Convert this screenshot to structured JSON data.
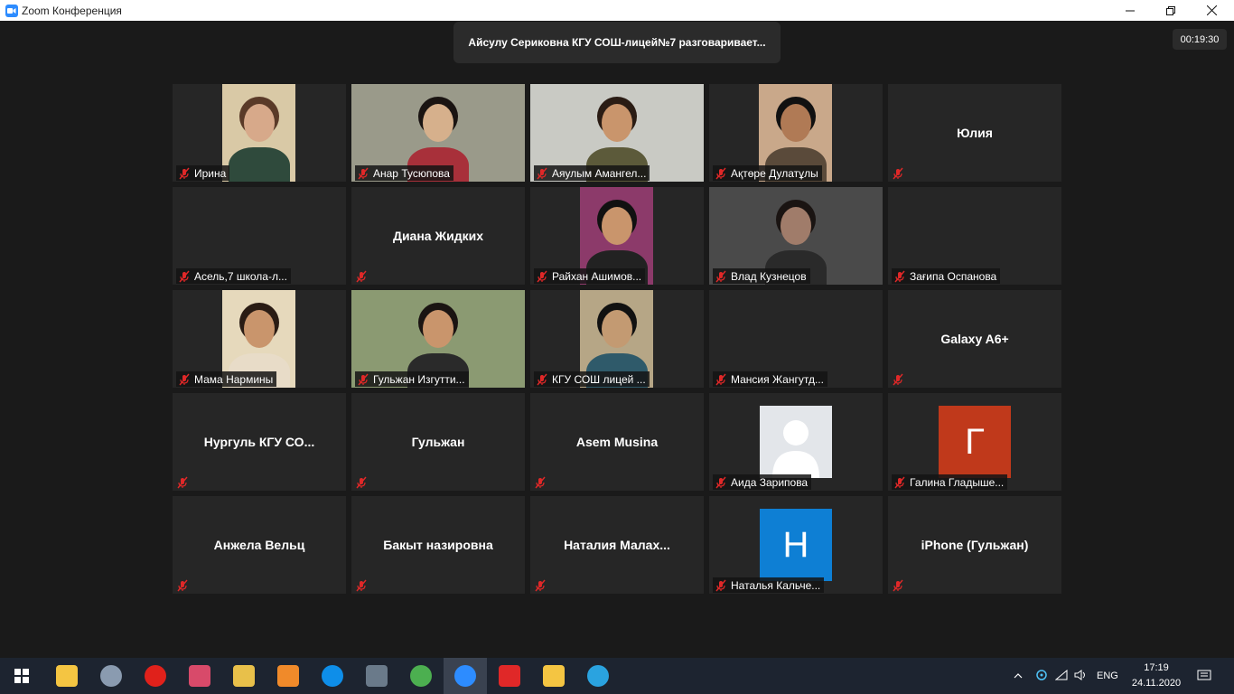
{
  "window": {
    "title": "Zoom Конференция"
  },
  "speaker_banner": "Айсулу Сериковна КГУ СОШ-лицей№7 разговаривает...",
  "timer": "00:19:30",
  "tiles": [
    {
      "label": "Ирина",
      "video": "irina"
    },
    {
      "label": "Анар Тусюпова",
      "video": "anar"
    },
    {
      "label": "Аяулым Амангел...",
      "video": "ayaulym"
    },
    {
      "label": "Ақтөре Дулатұлы",
      "video": "aktore"
    },
    {
      "label": "",
      "center": "Юлия"
    },
    {
      "label": "Асель,7 школа-л...",
      "center": ""
    },
    {
      "label": "",
      "center": "Диана Жидких"
    },
    {
      "label": "Райхан Ашимов...",
      "video": "raikhan"
    },
    {
      "label": "Влад Кузнецов",
      "video": "vlad"
    },
    {
      "label": "Зағипа Оспанова",
      "center": ""
    },
    {
      "label": "Мама Нармины",
      "video": "mama"
    },
    {
      "label": "Гульжан Изгутти...",
      "video": "gulzhan_iz"
    },
    {
      "label": "КГУ СОШ лицей ...",
      "video": "kgu"
    },
    {
      "label": "Мансия Жангутд...",
      "center": ""
    },
    {
      "label": "",
      "center": "Galaxy A6+"
    },
    {
      "label": "",
      "center": "Нургуль  КГУ  СО..."
    },
    {
      "label": "",
      "center": "Гульжан"
    },
    {
      "label": "",
      "center": "Asem Musina"
    },
    {
      "label": "Аида Зарипова",
      "avatar": "default"
    },
    {
      "label": "Галина Гладыше...",
      "avatar": "letter",
      "letter": "Г",
      "color": "#c0391b"
    },
    {
      "label": "",
      "center": "Анжела Вельц"
    },
    {
      "label": "",
      "center": "Бакыт назировна"
    },
    {
      "label": "",
      "center": "Наталия  Малах..."
    },
    {
      "label": "Наталья Кальче...",
      "avatar": "letter",
      "letter": "Н",
      "color": "#0e7fd4"
    },
    {
      "label": "",
      "center": "iPhone (Гульжан)"
    }
  ],
  "taskbar": {
    "icons": [
      "windows-start-icon",
      "camera-icon",
      "explorer-icon",
      "opera-icon",
      "paint-icon",
      "palette-icon",
      "cat-icon",
      "teamviewer-icon",
      "calculator-icon",
      "chrome-icon",
      "zoom-icon",
      "yandex-icon",
      "stats-icon",
      "telegram-icon"
    ],
    "lang": "ENG",
    "time": "17:19",
    "date": "24.11.2020"
  }
}
